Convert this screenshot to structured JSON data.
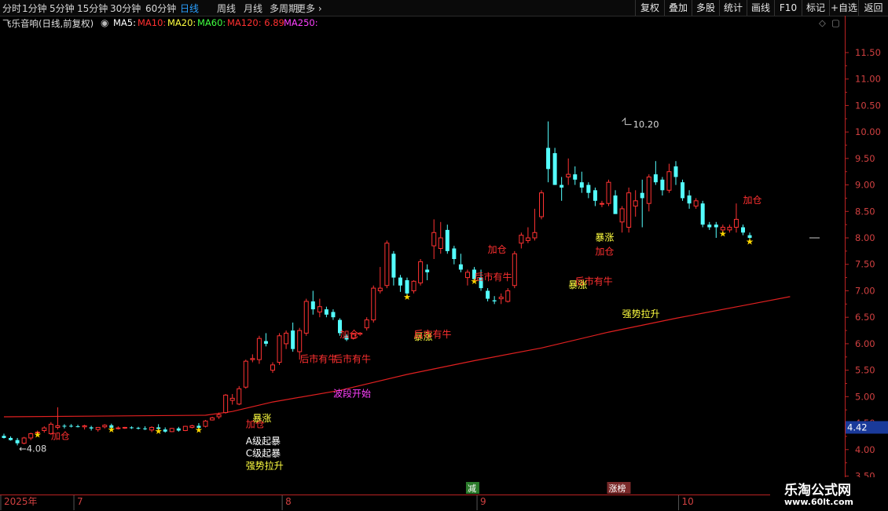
{
  "toolbar": {
    "periods": [
      "分时",
      "1分钟",
      "5分钟",
      "15分钟",
      "30分钟",
      "60分钟",
      "日线",
      "周线",
      "月线",
      "多周期",
      "更多"
    ],
    "active_period": "日线",
    "buttons": [
      "复权",
      "叠加",
      "多股",
      "统计",
      "画线",
      "F10",
      "标记",
      "+自选",
      "返回"
    ]
  },
  "info": {
    "stock_title": "飞乐音响(日线,前复权)",
    "ma5": "MA5:",
    "ma10": "MA10:",
    "ma20": "MA20:",
    "ma60": "MA60:",
    "ma120": "MA120: 6.89",
    "ma250": "MA250:",
    "colors": {
      "ma5": "#ffffff",
      "ma10": "#ff3030",
      "ma20": "#ffff40",
      "ma60": "#40ff40",
      "ma120": "#ff3030",
      "ma250": "#ff40ff"
    }
  },
  "chart_data": {
    "type": "candlestick",
    "ylim": [
      3.3,
      11.9
    ],
    "y_ticks": [
      "3.50",
      "4.00",
      "4.50",
      "5.00",
      "5.50",
      "6.00",
      "6.50",
      "7.00",
      "7.50",
      "8.00",
      "8.50",
      "9.00",
      "9.50",
      "10.00",
      "10.50",
      "11.00",
      "11.50"
    ],
    "x_labels": [
      {
        "text": "2025年",
        "idx": 0
      },
      {
        "text": "7",
        "idx": 11
      },
      {
        "text": "8",
        "idx": 42
      },
      {
        "text": "9",
        "idx": 71
      },
      {
        "text": "10",
        "idx": 101
      }
    ],
    "ohlc": [
      [
        4.26,
        4.3,
        4.21,
        4.22
      ],
      [
        4.22,
        4.25,
        4.17,
        4.18
      ],
      [
        4.18,
        4.22,
        4.08,
        4.12
      ],
      [
        4.12,
        4.24,
        4.1,
        4.22
      ],
      [
        4.22,
        4.32,
        4.18,
        4.3
      ],
      [
        4.32,
        4.36,
        4.3,
        4.33
      ],
      [
        4.36,
        4.44,
        4.32,
        4.41
      ],
      [
        4.3,
        4.52,
        4.28,
        4.48
      ],
      [
        4.42,
        4.8,
        4.38,
        4.45
      ],
      [
        4.45,
        4.48,
        4.4,
        4.44
      ],
      [
        4.45,
        4.48,
        4.42,
        4.44
      ],
      [
        4.44,
        4.47,
        4.42,
        4.43
      ],
      [
        4.43,
        4.47,
        4.38,
        4.45
      ],
      [
        4.42,
        4.45,
        4.36,
        4.4
      ],
      [
        4.38,
        4.42,
        4.34,
        4.42
      ],
      [
        4.43,
        4.48,
        4.4,
        4.46
      ],
      [
        4.46,
        4.49,
        4.4,
        4.41
      ],
      [
        4.4,
        4.44,
        4.38,
        4.41
      ],
      [
        4.41,
        4.43,
        4.39,
        4.42
      ],
      [
        4.42,
        4.44,
        4.39,
        4.41
      ],
      [
        4.41,
        4.43,
        4.38,
        4.4
      ],
      [
        4.4,
        4.44,
        4.37,
        4.39
      ],
      [
        4.37,
        4.44,
        4.33,
        4.42
      ],
      [
        4.42,
        4.48,
        4.37,
        4.39
      ],
      [
        4.38,
        4.42,
        4.32,
        4.34
      ],
      [
        4.34,
        4.41,
        4.33,
        4.4
      ],
      [
        4.4,
        4.43,
        4.34,
        4.36
      ],
      [
        4.36,
        4.45,
        4.35,
        4.44
      ],
      [
        4.42,
        4.47,
        4.4,
        4.45
      ],
      [
        4.45,
        4.5,
        4.39,
        4.41
      ],
      [
        4.44,
        4.56,
        4.42,
        4.54
      ],
      [
        4.56,
        4.62,
        4.55,
        4.6
      ],
      [
        4.62,
        4.7,
        4.58,
        4.66
      ],
      [
        4.7,
        5.05,
        4.68,
        5.03
      ],
      [
        4.93,
        5.05,
        4.85,
        4.97
      ],
      [
        4.86,
        5.2,
        4.84,
        5.15
      ],
      [
        5.18,
        5.7,
        5.15,
        5.67
      ],
      [
        5.7,
        5.8,
        5.65,
        5.72
      ],
      [
        5.7,
        6.15,
        5.62,
        6.1
      ],
      [
        6.05,
        6.2,
        5.95,
        6.0
      ],
      [
        5.5,
        5.65,
        5.45,
        5.6
      ],
      [
        5.65,
        6.2,
        5.6,
        6.15
      ],
      [
        6.0,
        6.25,
        5.9,
        6.2
      ],
      [
        6.25,
        6.4,
        5.85,
        5.9
      ],
      [
        5.85,
        6.3,
        5.7,
        6.25
      ],
      [
        6.2,
        6.85,
        6.15,
        6.8
      ],
      [
        6.8,
        7.0,
        6.55,
        6.65
      ],
      [
        6.6,
        6.85,
        6.5,
        6.7
      ],
      [
        6.65,
        6.7,
        6.5,
        6.55
      ],
      [
        6.6,
        6.65,
        6.45,
        6.5
      ],
      [
        6.45,
        6.48,
        6.15,
        6.2
      ],
      [
        6.15,
        6.18,
        6.05,
        6.08
      ],
      [
        6.1,
        6.2,
        6.08,
        6.18
      ],
      [
        6.18,
        6.22,
        6.15,
        6.2
      ],
      [
        6.3,
        6.5,
        6.25,
        6.45
      ],
      [
        6.45,
        7.1,
        6.4,
        7.05
      ],
      [
        7.0,
        7.45,
        6.95,
        7.05
      ],
      [
        7.1,
        7.95,
        7.05,
        7.9
      ],
      [
        7.7,
        7.75,
        7.1,
        7.25
      ],
      [
        7.25,
        7.3,
        6.98,
        7.1
      ],
      [
        7.2,
        7.25,
        6.9,
        6.95
      ],
      [
        7.0,
        7.2,
        6.95,
        7.18
      ],
      [
        7.15,
        7.6,
        7.1,
        7.55
      ],
      [
        7.4,
        7.5,
        7.2,
        7.35
      ],
      [
        7.85,
        8.35,
        7.6,
        8.1
      ],
      [
        7.8,
        8.3,
        7.7,
        8.0
      ],
      [
        8.15,
        8.25,
        7.7,
        7.75
      ],
      [
        7.8,
        7.85,
        7.5,
        7.6
      ],
      [
        7.5,
        7.7,
        7.35,
        7.4
      ],
      [
        7.25,
        7.4,
        7.1,
        7.35
      ],
      [
        7.4,
        7.45,
        7.2,
        7.22
      ],
      [
        7.25,
        7.4,
        7.0,
        7.05
      ],
      [
        7.0,
        7.05,
        6.8,
        6.85
      ],
      [
        6.82,
        6.9,
        6.75,
        6.8
      ],
      [
        6.85,
        6.95,
        6.75,
        6.88
      ],
      [
        6.8,
        7.05,
        6.78,
        7.0
      ],
      [
        7.1,
        7.75,
        7.05,
        7.7
      ],
      [
        7.9,
        8.1,
        7.8,
        8.05
      ],
      [
        7.95,
        8.2,
        7.9,
        8.0
      ],
      [
        8.0,
        8.55,
        7.95,
        8.1
      ],
      [
        8.4,
        8.9,
        8.35,
        8.85
      ],
      [
        9.7,
        10.2,
        9.05,
        9.3
      ],
      [
        9.6,
        9.7,
        9.0,
        9.0
      ],
      [
        9.0,
        9.15,
        8.7,
        8.95
      ],
      [
        9.15,
        9.5,
        9.0,
        9.2
      ],
      [
        9.2,
        9.35,
        9.0,
        9.1
      ],
      [
        9.05,
        9.25,
        8.85,
        8.95
      ],
      [
        9.0,
        9.05,
        8.75,
        8.85
      ],
      [
        8.9,
        8.95,
        8.6,
        8.7
      ],
      [
        8.65,
        8.7,
        8.58,
        8.65
      ],
      [
        8.65,
        9.1,
        8.6,
        9.05
      ],
      [
        8.8,
        8.9,
        8.5,
        8.45
      ],
      [
        8.3,
        8.6,
        8.1,
        8.55
      ],
      [
        8.2,
        8.95,
        8.1,
        8.85
      ],
      [
        8.6,
        8.9,
        8.4,
        8.7
      ],
      [
        8.85,
        9.1,
        8.2,
        8.75
      ],
      [
        8.65,
        9.2,
        8.5,
        9.15
      ],
      [
        9.2,
        9.45,
        9.0,
        9.05
      ],
      [
        9.1,
        9.15,
        8.8,
        8.9
      ],
      [
        8.9,
        9.4,
        8.85,
        9.25
      ],
      [
        9.35,
        9.45,
        9.0,
        9.15
      ],
      [
        9.05,
        9.1,
        8.7,
        8.75
      ],
      [
        8.8,
        8.9,
        8.55,
        8.65
      ],
      [
        8.6,
        8.75,
        8.55,
        8.7
      ],
      [
        8.65,
        8.7,
        8.2,
        8.25
      ],
      [
        8.25,
        8.3,
        8.15,
        8.2
      ],
      [
        8.25,
        8.3,
        8.0,
        8.2
      ],
      [
        8.15,
        8.25,
        8.1,
        8.2
      ],
      [
        8.15,
        8.25,
        8.1,
        8.2
      ],
      [
        8.2,
        8.65,
        8.1,
        8.35
      ],
      [
        8.2,
        8.25,
        8.05,
        8.1
      ],
      [
        8.05,
        8.1,
        7.95,
        8.0
      ]
    ],
    "ma120_name": "MA120",
    "ma120_points": [
      [
        0,
        4.62
      ],
      [
        30,
        4.65
      ],
      [
        34,
        4.72
      ],
      [
        40,
        4.9
      ],
      [
        50,
        5.12
      ],
      [
        60,
        5.42
      ],
      [
        70,
        5.68
      ],
      [
        80,
        5.92
      ],
      [
        90,
        6.22
      ],
      [
        100,
        6.48
      ],
      [
        110,
        6.72
      ],
      [
        117,
        6.89
      ]
    ],
    "signal_texts": [
      {
        "text": "加仓",
        "color": "#ff3030",
        "idx": 7,
        "y": 4.2
      },
      {
        "text": "加仓",
        "color": "#ff3030",
        "idx": 36,
        "y": 4.42
      },
      {
        "text": "暴涨",
        "color": "#ffff40",
        "idx": 37,
        "y": 4.53
      },
      {
        "text": "A级起暴",
        "color": "#ffffff",
        "idx": 36,
        "y": 4.1
      },
      {
        "text": "C级起暴",
        "color": "#ffffff",
        "idx": 36,
        "y": 3.87
      },
      {
        "text": "强势拉升",
        "color": "#ffff40",
        "idx": 36,
        "y": 3.63
      },
      {
        "text": "波段开始",
        "color": "#ff40ff",
        "idx": 49,
        "y": 5.0
      },
      {
        "text": "后市有牛",
        "color": "#ff3030",
        "idx": 44,
        "y": 5.65
      },
      {
        "text": "后市有牛",
        "color": "#ff3030",
        "idx": 49,
        "y": 5.65
      },
      {
        "text": "加仓",
        "color": "#ff3030",
        "idx": 50,
        "y": 6.12
      },
      {
        "text": "暴涨",
        "color": "#ffff40",
        "idx": 61,
        "y": 6.07
      },
      {
        "text": "后市有牛",
        "color": "#ff3030",
        "idx": 61,
        "y": 6.12
      },
      {
        "text": "后市有牛",
        "color": "#ff3030",
        "idx": 70,
        "y": 7.2
      },
      {
        "text": "加仓",
        "color": "#ff3030",
        "idx": 72,
        "y": 7.72
      },
      {
        "text": "暴涨",
        "color": "#ffff40",
        "idx": 88,
        "y": 7.95
      },
      {
        "text": "加仓",
        "color": "#ff3030",
        "idx": 88,
        "y": 7.68
      },
      {
        "text": "后市有牛",
        "color": "#ff3030",
        "idx": 85,
        "y": 7.12
      },
      {
        "text": "暴涨",
        "color": "#ffff40",
        "idx": 84,
        "y": 7.05
      },
      {
        "text": "强势拉升",
        "color": "#ffff40",
        "idx": 92,
        "y": 6.5
      },
      {
        "text": "加仓",
        "color": "#ff3030",
        "idx": 110,
        "y": 8.65
      }
    ],
    "stars": [
      5,
      16,
      23,
      29,
      60,
      70,
      107,
      115,
      128
    ],
    "high_label": {
      "text": "10.20",
      "idx": 92,
      "y": 10.2
    },
    "low_label": {
      "text": "4.08",
      "idx": 2,
      "y": 4.08
    },
    "last_price": "4.42",
    "events": [
      {
        "text": "减",
        "color": "#ffffff",
        "bg": "#2a7a2a",
        "idx": 69
      },
      {
        "text": "涨榜",
        "color": "#ffffff",
        "bg": "#7a2a2a",
        "idx": 90
      }
    ]
  },
  "brand": {
    "name": "乐淘公式网",
    "url": "www.60lt.com"
  }
}
